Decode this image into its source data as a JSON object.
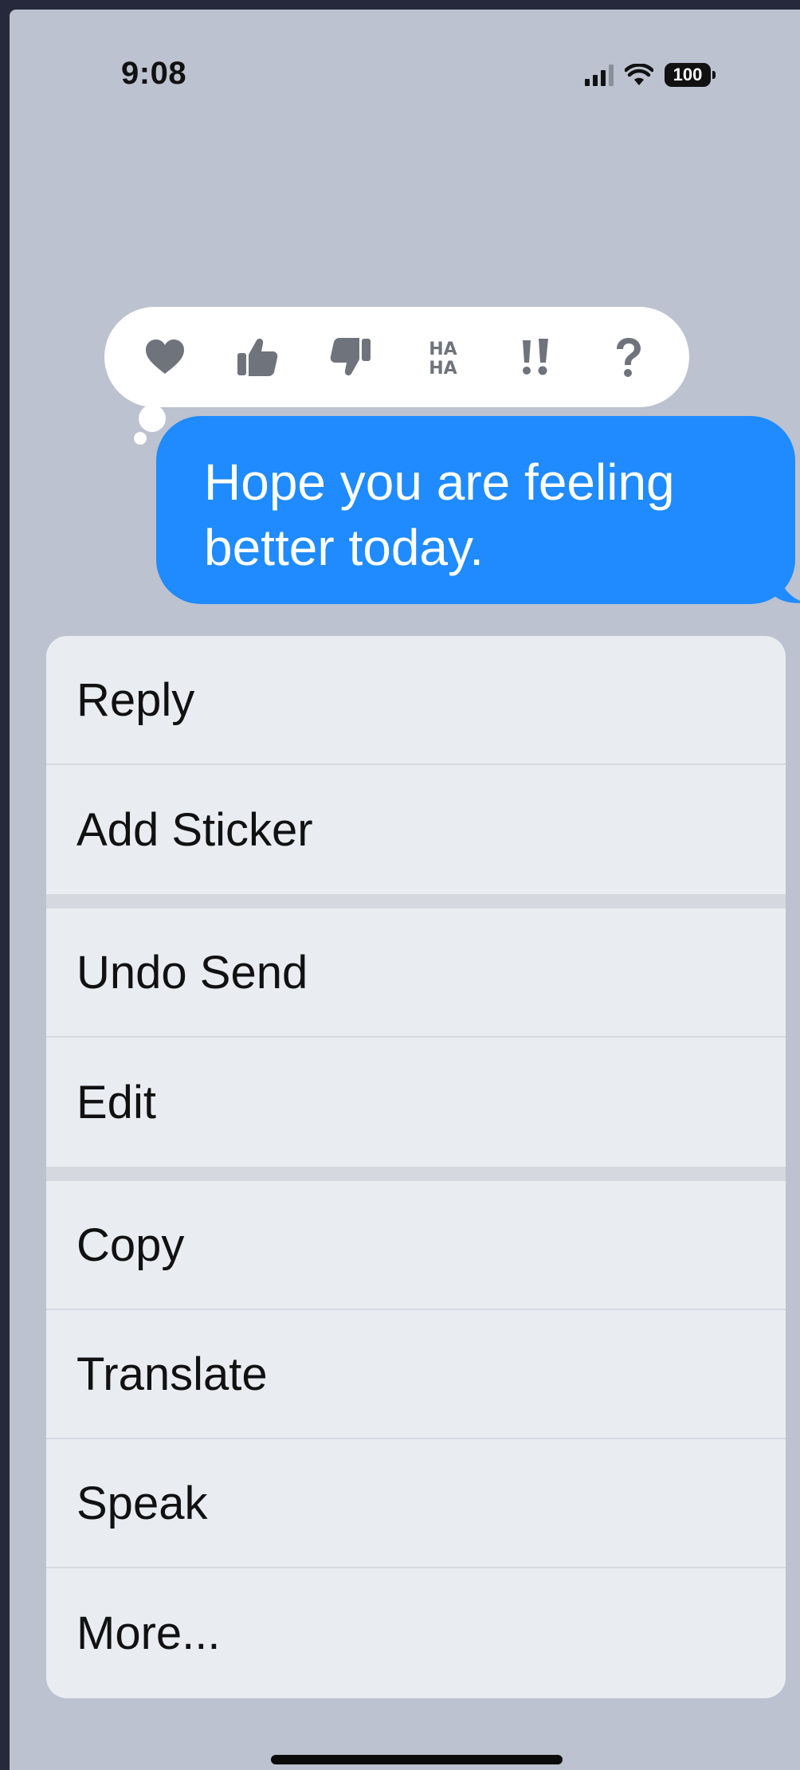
{
  "status_bar": {
    "time": "9:08",
    "battery": "100",
    "icons": [
      "signal-icon",
      "wifi-icon",
      "battery-icon"
    ]
  },
  "tapback": {
    "reactions": [
      {
        "name": "heart",
        "icon": "heart-icon"
      },
      {
        "name": "thumbs-up",
        "icon": "thumbs-up-icon"
      },
      {
        "name": "thumbs-down",
        "icon": "thumbs-down-icon"
      },
      {
        "name": "haha",
        "icon": "haha-icon"
      },
      {
        "name": "emphasize",
        "icon": "exclamation-icon"
      },
      {
        "name": "question",
        "icon": "question-icon"
      }
    ]
  },
  "message": {
    "line1": "Hope you are feeling",
    "line2": "better today.",
    "bubble_color": "#1f8bff"
  },
  "menu": {
    "reply": "Reply",
    "add_sticker": "Add Sticker",
    "undo_send": "Undo Send",
    "edit": "Edit",
    "copy": "Copy",
    "translate": "Translate",
    "speak": "Speak",
    "more": "More..."
  },
  "colors": {
    "backdrop": "#bcc2cf",
    "menu_background": "#e9ecf1",
    "accent": "#1f8bff"
  }
}
